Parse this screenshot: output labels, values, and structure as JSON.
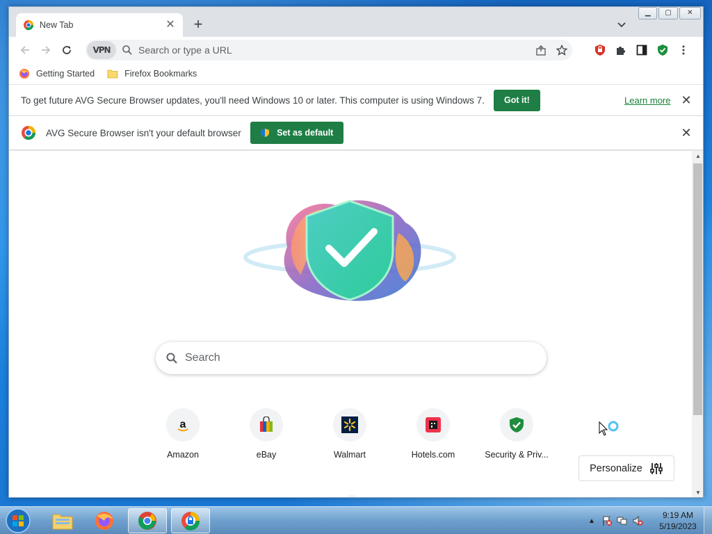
{
  "tab": {
    "title": "New Tab",
    "close": "✕",
    "new": "+"
  },
  "window": {
    "minimize": "▁",
    "maximize": "▢",
    "close": "✕"
  },
  "omnibox": {
    "vpn": "VPN",
    "placeholder": "Search or type a URL"
  },
  "bookmarks": [
    {
      "label": "Getting Started",
      "icon": "firefox-icon"
    },
    {
      "label": "Firefox Bookmarks",
      "icon": "folder-icon"
    }
  ],
  "infobar_update": {
    "text": "To get future AVG Secure Browser updates, you'll need Windows 10 or later. This computer is using Windows 7.",
    "button": "Got it!",
    "link": "Learn more",
    "close": "✕"
  },
  "infobar_default": {
    "text": "AVG Secure Browser isn't your default browser",
    "button": "Set as default",
    "close": "✕"
  },
  "ntp": {
    "search_placeholder": "Search",
    "tiles": [
      {
        "label": "Amazon",
        "icon": "amazon-icon"
      },
      {
        "label": "eBay",
        "icon": "ebay-icon"
      },
      {
        "label": "Walmart",
        "icon": "walmart-icon"
      },
      {
        "label": "Hotels.com",
        "icon": "hotels-icon"
      },
      {
        "label": "Security & Priv...",
        "icon": "shield-check-icon"
      }
    ],
    "personalize": "Personalize"
  },
  "taskbar": {
    "time": "9:19 AM",
    "date": "5/19/2023"
  },
  "colors": {
    "accent_green": "#1e7e45",
    "tab_strip": "#dee1e6"
  }
}
